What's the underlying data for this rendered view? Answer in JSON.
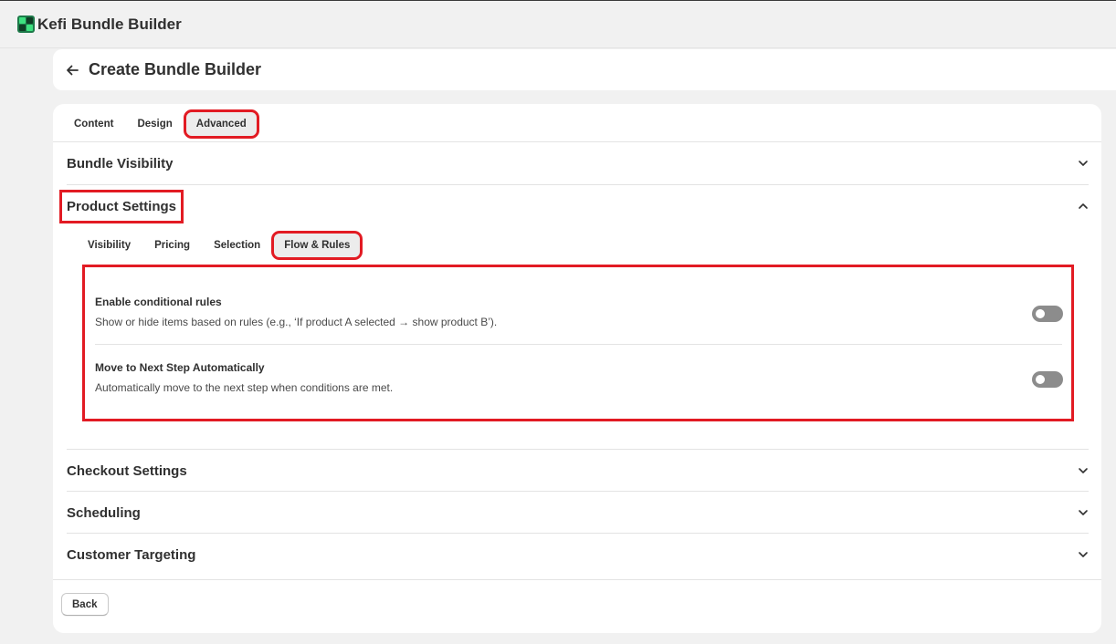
{
  "app": {
    "title": "Kefi Bundle Builder",
    "logo_icon": "kefi-logo-icon",
    "accent_color": "#29c36a"
  },
  "page": {
    "title": "Create Bundle Builder",
    "back_icon": "arrow-left-icon"
  },
  "top_tabs": [
    {
      "label": "Content",
      "active": false
    },
    {
      "label": "Design",
      "active": false
    },
    {
      "label": "Advanced",
      "active": true
    }
  ],
  "sections": {
    "bundle_visibility": {
      "title": "Bundle Visibility",
      "expanded": false
    },
    "product_settings": {
      "title": "Product Settings",
      "expanded": true,
      "sub_tabs": [
        {
          "label": "Visibility",
          "active": false
        },
        {
          "label": "Pricing",
          "active": false
        },
        {
          "label": "Selection",
          "active": false
        },
        {
          "label": "Flow & Rules",
          "active": true
        }
      ],
      "rules": [
        {
          "title": "Enable conditional rules",
          "description": "Show or hide items based on rules (e.g., ‘If product A selected → show product B’).",
          "enabled": false
        },
        {
          "title": "Move to Next Step Automatically",
          "description": "Automatically move to the next step when conditions are met.",
          "enabled": false
        }
      ]
    },
    "checkout_settings": {
      "title": "Checkout Settings",
      "expanded": false
    },
    "scheduling": {
      "title": "Scheduling",
      "expanded": false
    },
    "customer_targeting": {
      "title": "Customer Targeting",
      "expanded": false
    }
  },
  "footer": {
    "back_label": "Back"
  },
  "colors": {
    "highlight": "#e21b23",
    "toggle_off": "#8c8c8c"
  }
}
